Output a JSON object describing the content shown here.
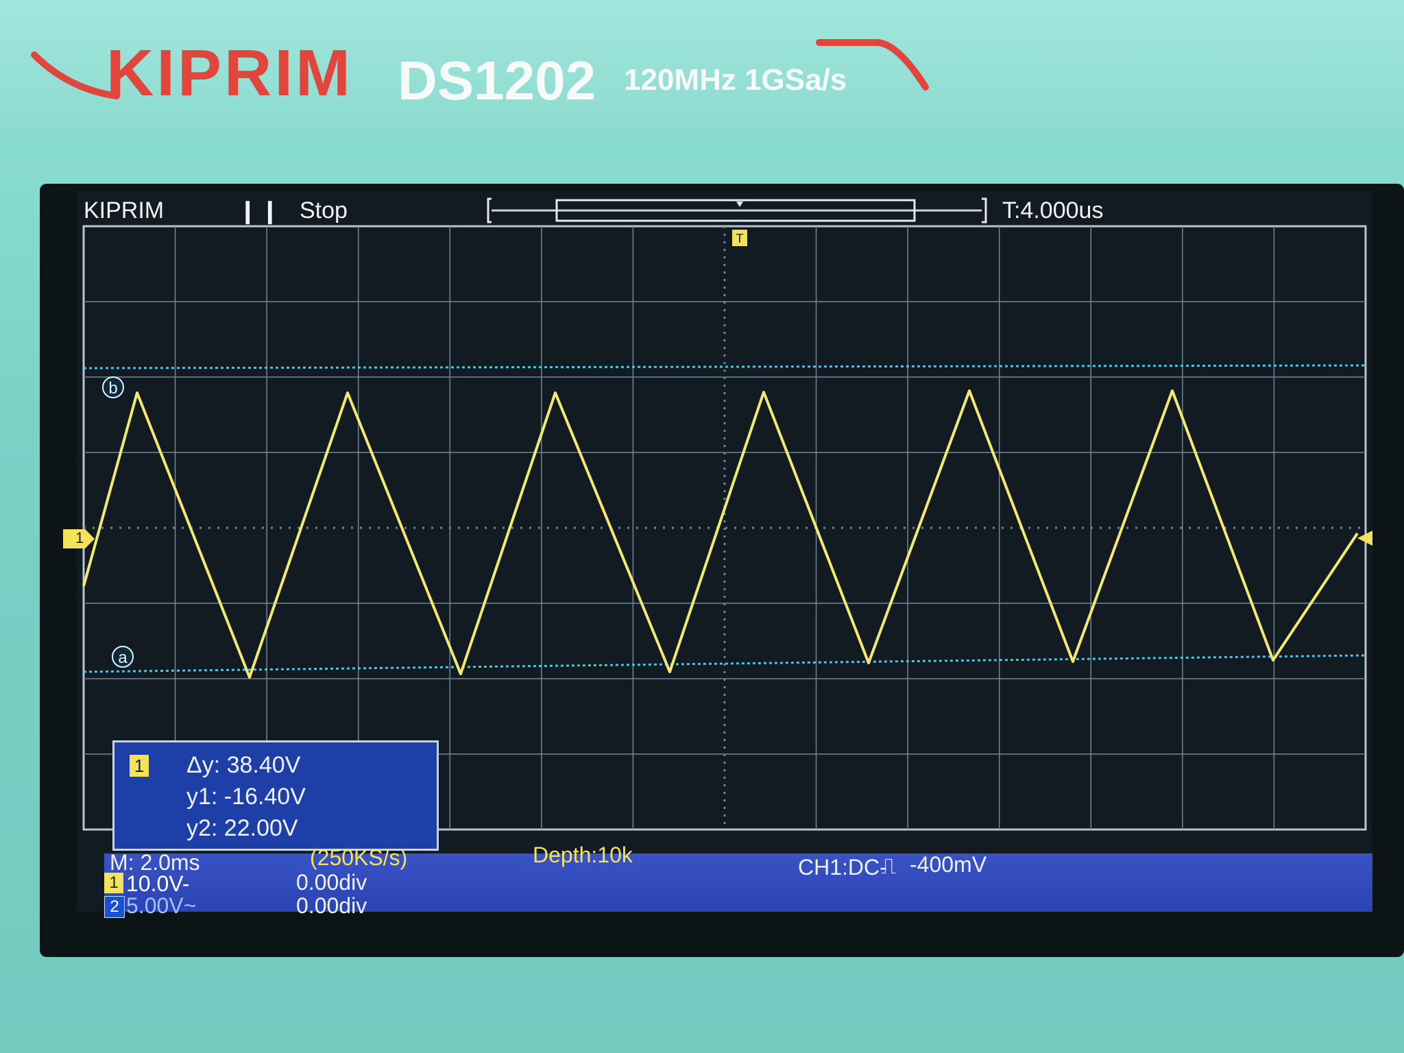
{
  "device": {
    "brand": "KIPRIM",
    "model": "DS1202",
    "spec": "120MHz 1GSa/s"
  },
  "status": {
    "brand": "KIPRIM",
    "run_state_icon": "pause-icon",
    "run_state": "Stop",
    "trigger_time": "T:4.000us"
  },
  "cursors": {
    "a_label": "a",
    "b_label": "b"
  },
  "channel_marker": "1",
  "measurement": {
    "channel": "1",
    "dy": "Δy: 38.40V",
    "y1": "y1: -16.40V",
    "y2": "y2: 22.00V"
  },
  "bottom": {
    "timebase": "M: 2.0ms",
    "sample_rate": "(250KS/s)",
    "depth": "Depth:10k",
    "trigger": "CH1:DC-",
    "trigger_level": "-400mV",
    "ch1_num": "1",
    "ch1_scale": "10.0V-",
    "ch1_offset": "0.00div",
    "ch2_num": "2",
    "ch2_scale": "5.00V~",
    "ch2_offset": "0.00div"
  },
  "colors": {
    "trace": "#f3e870",
    "cursor": "#47c7e8",
    "grid": "#6f8797",
    "info_blue": "#2b44b4"
  },
  "waveform": {
    "shape": "triangle",
    "peaks_visible": 6,
    "high_v": 22.0,
    "low_v": -16.4
  }
}
